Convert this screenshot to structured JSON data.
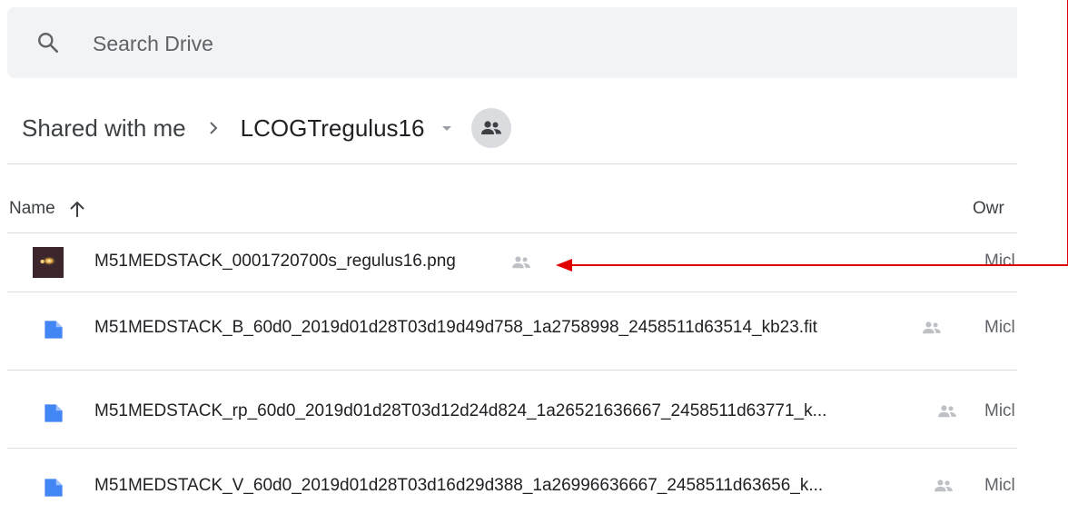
{
  "search": {
    "placeholder": "Search Drive"
  },
  "breadcrumb": {
    "parent": "Shared with me",
    "current": "LCOGTregulus16"
  },
  "columns": {
    "name": "Name",
    "owner": "Owr"
  },
  "files": [
    {
      "name": "M51MEDSTACK_0001720700s_regulus16.png",
      "owner": "Micl",
      "type": "image"
    },
    {
      "name": "M51MEDSTACK_B_60d0_2019d01d28T03d19d49d758_1a2758998_2458511d63514_kb23.fit",
      "owner": "Micl",
      "type": "file"
    },
    {
      "name": "M51MEDSTACK_rp_60d0_2019d01d28T03d12d24d824_1a26521636667_2458511d63771_k...",
      "owner": "Micl",
      "type": "file"
    },
    {
      "name": "M51MEDSTACK_V_60d0_2019d01d28T03d16d29d388_1a26996636667_2458511d63656_k...",
      "owner": "Micl",
      "type": "file"
    }
  ],
  "colors": {
    "file_icon": "#4285f4",
    "annotation": "#e00000",
    "divider": "#dadce0"
  }
}
